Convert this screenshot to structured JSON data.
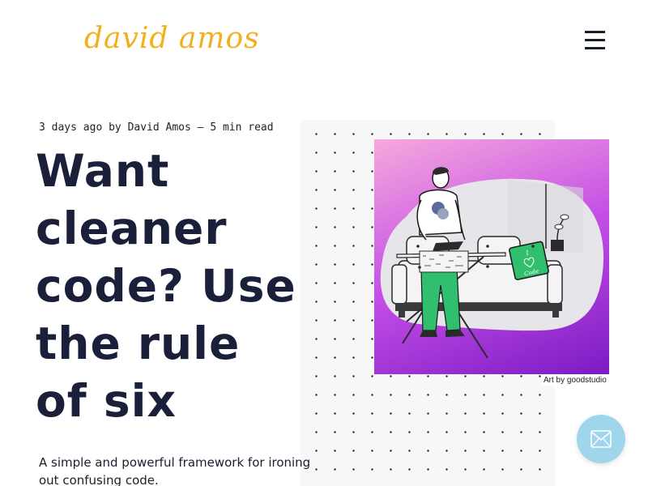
{
  "header": {
    "logo_text": "david amos",
    "menu_icon": "hamburger-menu-icon"
  },
  "article": {
    "meta": "3 days ago by David Amos — 5 min read",
    "title": "Want cleaner code? Use the rule of six",
    "subtitle": "A simple and powerful framework for ironing out confusing code."
  },
  "hero_image": {
    "credit": "Art by goodstudio",
    "pillow_text": "I ♡ Code",
    "colors": {
      "gradient_start": "#f6a9dd",
      "gradient_end": "#7b1bc4",
      "pants": "#2fbf6e",
      "pillow": "#2fbf6e"
    }
  },
  "contact": {
    "icon": "envelope-icon",
    "button_color": "#9fd6ec"
  },
  "colors": {
    "logo": "#f2b01e",
    "title": "#1a1f3a",
    "text": "#1a1f2c"
  }
}
